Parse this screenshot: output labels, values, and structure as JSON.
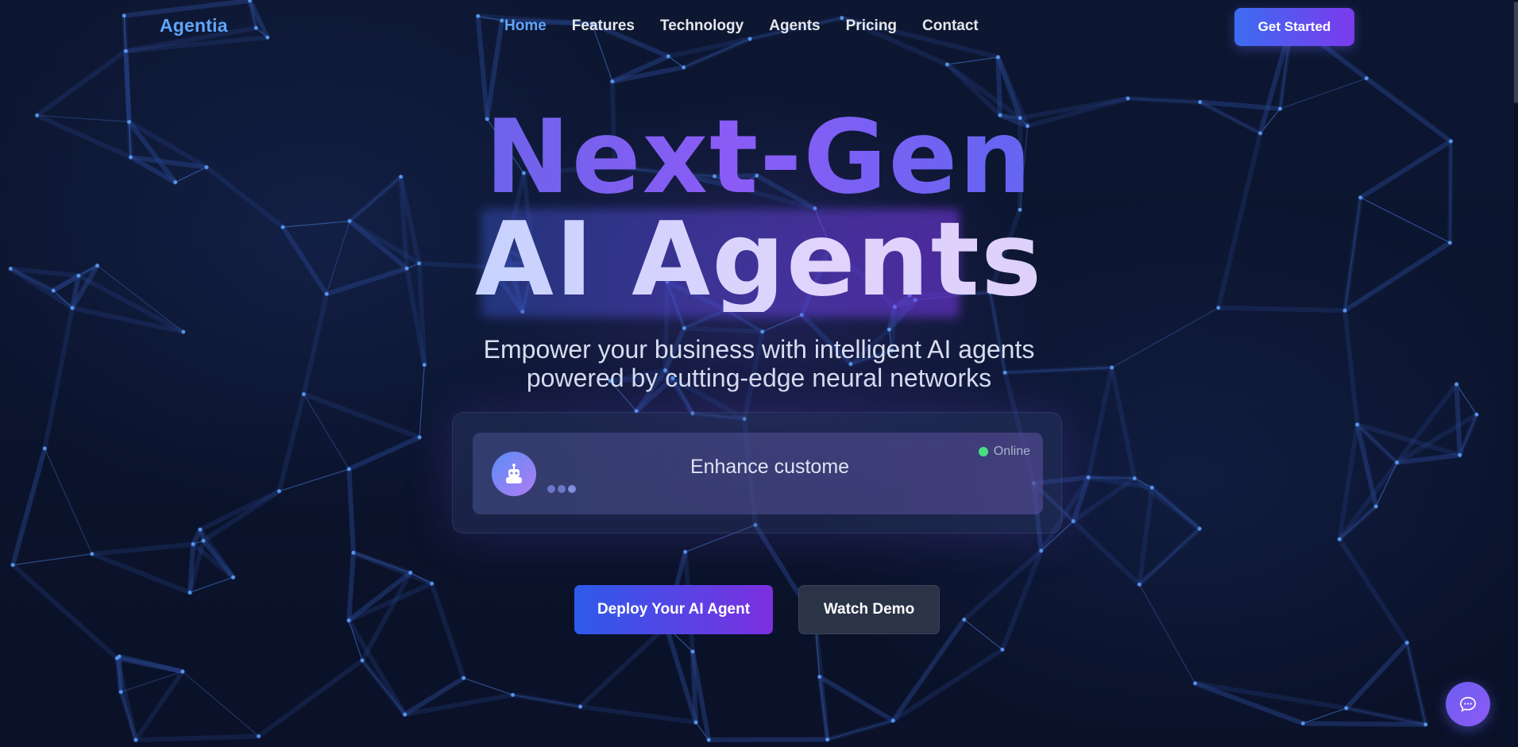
{
  "nav": {
    "logo": "Agentia",
    "links": [
      "Home",
      "Features",
      "Technology",
      "Agents",
      "Pricing",
      "Contact"
    ],
    "active_index": 0,
    "cta_label": "Get Started"
  },
  "hero": {
    "title_line1": "Next-Gen",
    "title_line2": "AI Agents",
    "subtitle_line1": "Empower your business with intelligent AI agents",
    "subtitle_line2": "powered by cutting-edge neural networks"
  },
  "chat_demo": {
    "agent_icon": "robot-icon",
    "typing_text": "Enhance custome",
    "status_label": "Online",
    "status_color": "#4ade80"
  },
  "actions": {
    "primary_label": "Deploy Your AI Agent",
    "secondary_label": "Watch Demo"
  },
  "chat_fab_icon": "chat-bubble-icon",
  "colors": {
    "accent": "#60a5fa",
    "brand_gradient_start": "#3b6cf0",
    "brand_gradient_end": "#7c3aed",
    "background": "#0a1128"
  }
}
